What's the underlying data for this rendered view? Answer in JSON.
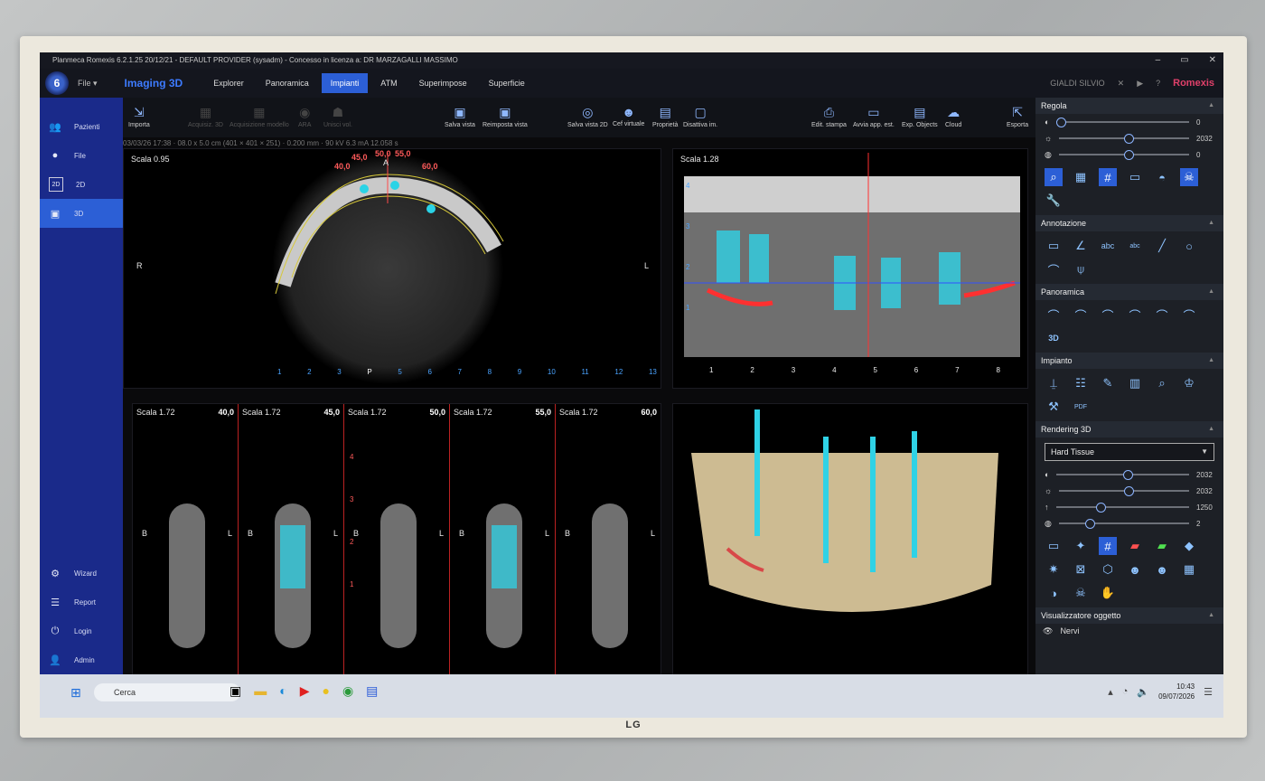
{
  "window": {
    "title": "Planmeca Romexis 6.2.1.25 20/12/21 - DEFAULT PROVIDER (sysadm) - Concesso in licenza a: DR MARZAGALLI MASSIMO"
  },
  "menu": {
    "file": "File",
    "module_title": "Imaging 3D",
    "tabs": [
      "Explorer",
      "Panoramica",
      "Impianti",
      "ATM",
      "Superimpose",
      "Superficie"
    ],
    "active_tab": "Impianti",
    "patient": "GIALDI SILVIO",
    "brand": "Romexis"
  },
  "sidebar": {
    "items": [
      {
        "label": "Pazienti",
        "icon": "patients-icon"
      },
      {
        "label": "File",
        "icon": "file-icon"
      },
      {
        "label": "2D",
        "icon": "2d-icon"
      },
      {
        "label": "3D",
        "icon": "3d-icon"
      }
    ],
    "bottom": [
      {
        "label": "Wizard"
      },
      {
        "label": "Report"
      },
      {
        "label": "Login"
      },
      {
        "label": "Admin"
      }
    ]
  },
  "toolbar": {
    "importa": "Importa",
    "acquis3d": "Acquisiz. 3D",
    "acqmodello": "Acquisizione modello",
    "ara": "ARA",
    "unisci": "Unisci vol.",
    "salva": "Salva vista",
    "reimposta": "Reimposta vista",
    "salva2d": "Salva vista 2D",
    "cef": "Cef virtuale",
    "proprieta": "Proprietà",
    "disattiva": "Disattiva im.",
    "edit": "Edit. stampa",
    "avvia": "Avvia app. est.",
    "exp": "Exp. Objects",
    "cloud": "Cloud",
    "esporta": "Esporta"
  },
  "info": "03/03/26 17:38 · 08.0 x 5.0 cm (401 × 401 × 251) · 0.200 mm · 90 kV 6.3 mA 12.058 s",
  "axial": {
    "scala": "Scala 0.95",
    "labels": [
      "40,0",
      "45,0",
      "50,0",
      "55,0",
      "60,0"
    ],
    "a": "A",
    "p": "P",
    "r": "R",
    "l": "L"
  },
  "pano": {
    "scala": "Scala 1.28",
    "yticks": [
      "4",
      "3",
      "2",
      "1"
    ],
    "xticks": [
      "1",
      "2",
      "3",
      "4",
      "5",
      "6",
      "7",
      "8"
    ]
  },
  "axial_ruler": [
    "1",
    "2",
    "3",
    "P",
    "5",
    "6",
    "7",
    "8",
    "9",
    "10",
    "11",
    "12",
    "13"
  ],
  "cross": [
    {
      "scala": "Scala 1.72",
      "pos": "40,0"
    },
    {
      "scala": "Scala 1.72",
      "pos": "45,0"
    },
    {
      "scala": "Scala 1.72",
      "pos": "50,0"
    },
    {
      "scala": "Scala 1.72",
      "pos": "55,0"
    },
    {
      "scala": "Scala 1.72",
      "pos": "60,0"
    }
  ],
  "cross_yticks": [
    "4",
    "3",
    "2",
    "1"
  ],
  "bl": {
    "b": "B",
    "l": "L"
  },
  "right_panel": {
    "regola": "Regola",
    "regola_sliders": [
      {
        "val": "0",
        "frac": 0
      },
      {
        "val": "2032",
        "frac": 0.5
      },
      {
        "val": "0",
        "frac": 0.5
      }
    ],
    "annotazione": "Annotazione",
    "panoramica": "Panoramica",
    "impianto": "Impianto",
    "rendering": "Rendering 3D",
    "render_mode": "Hard Tissue",
    "render_sliders": [
      {
        "val": "2032",
        "frac": 0.5
      },
      {
        "val": "2032",
        "frac": 0.5
      },
      {
        "val": "1250",
        "frac": 0.3
      },
      {
        "val": "2",
        "frac": 0.2
      }
    ],
    "visualizzatore": "Visualizzatore oggetto",
    "nervi": "Nervi"
  },
  "taskbar": {
    "search": "Cerca",
    "time": "10:43",
    "date": "09/07/2026"
  },
  "bezel": {
    "brand": "LG"
  }
}
